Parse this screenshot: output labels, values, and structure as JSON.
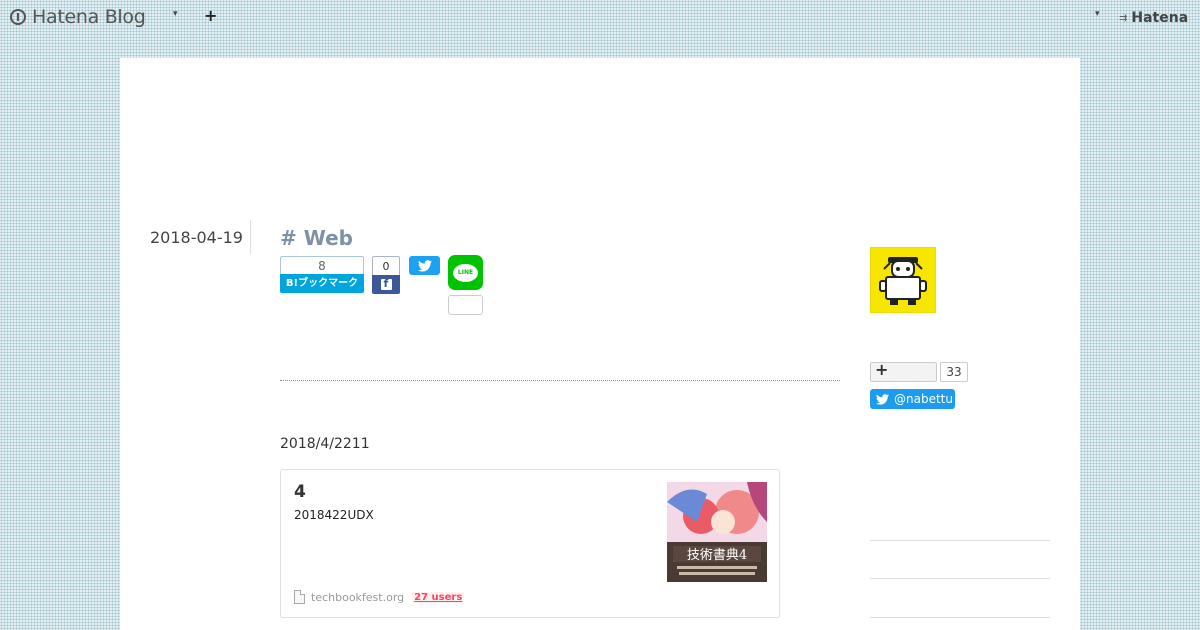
{
  "header": {
    "logo_text": "Hatena Blog",
    "menu_caret": "▾",
    "add_label": "+",
    "right_caret": "▾",
    "hatena_mark": "⇉",
    "hatena_label": "Hatena"
  },
  "entry": {
    "date": "2018-04-19",
    "category": "# Web",
    "bookmark_count": "8",
    "bookmark_label": "B!ブックマーク",
    "facebook_count": "0",
    "line_label": "LINE",
    "text": "2018/4/2211"
  },
  "card": {
    "title": "4",
    "description": "2018422UDX",
    "domain": "techbookfest.org",
    "users": "27 users"
  },
  "sidebar": {
    "follow_count": "33",
    "twitter_handle": "@nabettu"
  },
  "icons": [
    "hatena-logo-icon",
    "twitter-bird-icon",
    "facebook-f-icon",
    "line-icon",
    "document-icon",
    "avatar-icon",
    "book-cover-thumbnail"
  ]
}
